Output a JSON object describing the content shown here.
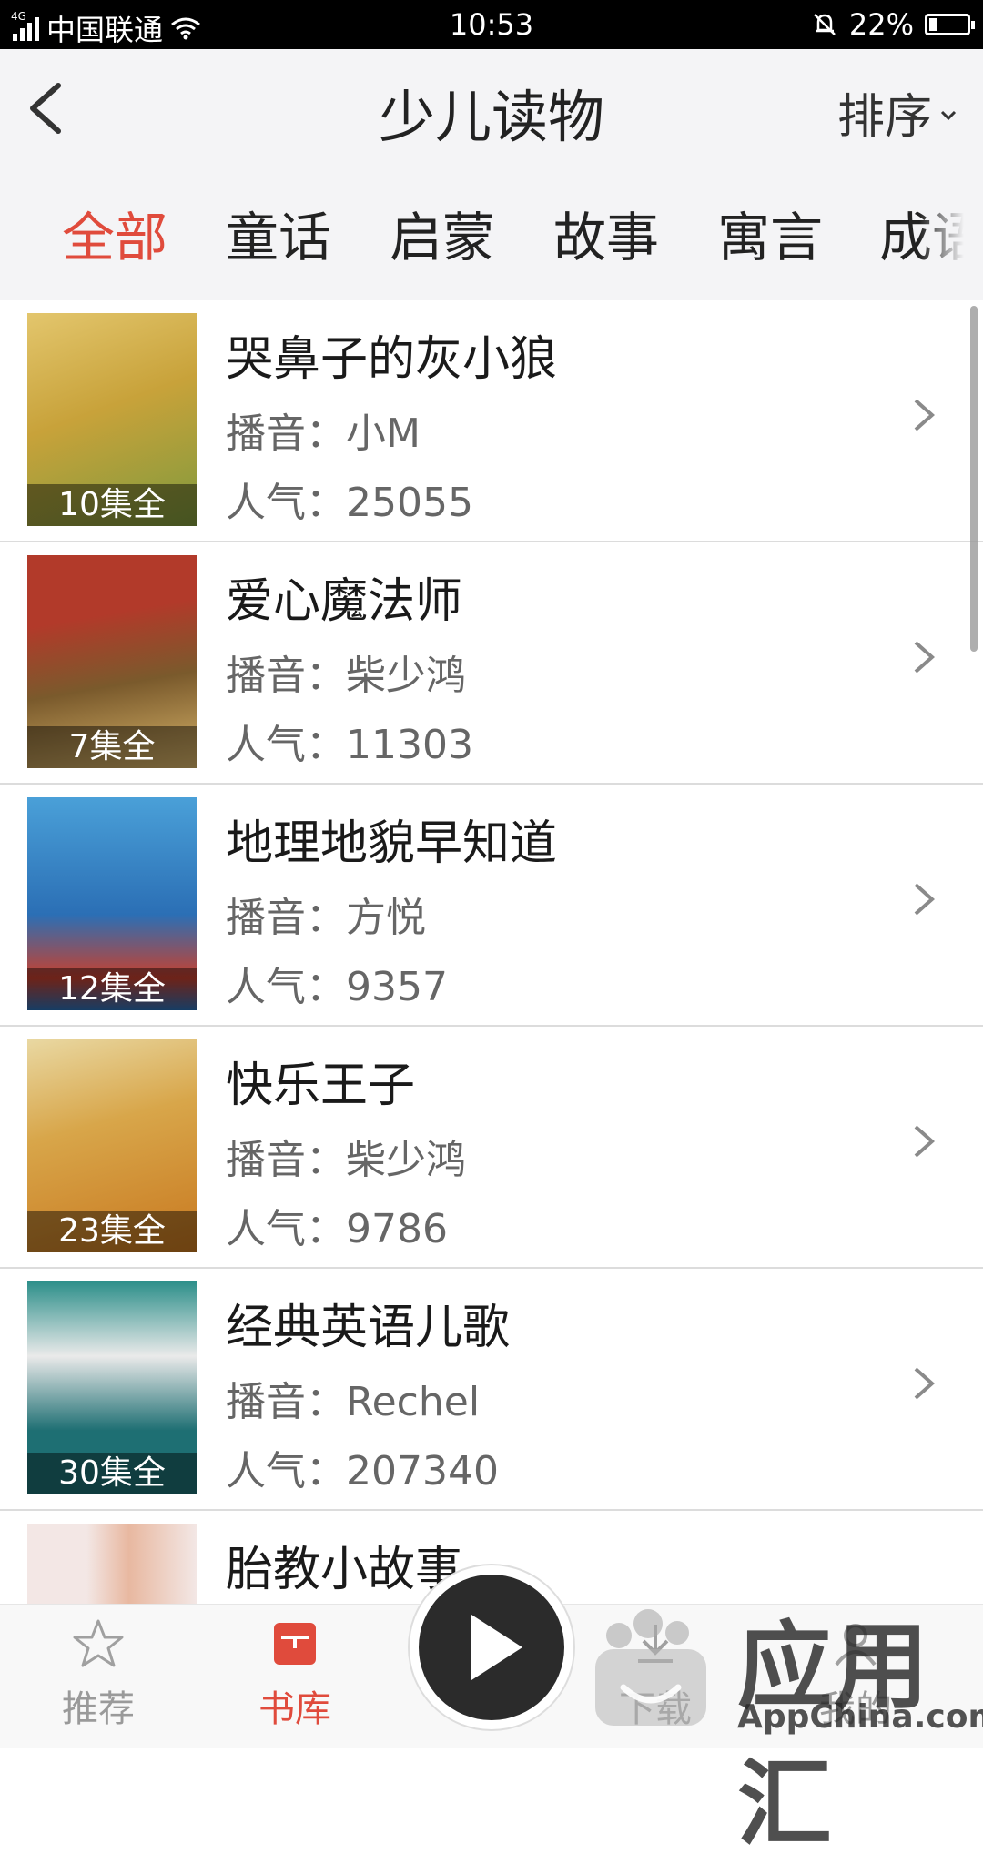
{
  "status_bar": {
    "signal": "4G",
    "carrier": "中国联通",
    "time": "10:53",
    "battery": "22%"
  },
  "header": {
    "title": "少儿读物",
    "sort_label": "排序",
    "back_icon": "chevron-left-icon",
    "sort_icon": "chevron-down-icon"
  },
  "tabs": [
    {
      "label": "全部",
      "active": true
    },
    {
      "label": "童话",
      "active": false
    },
    {
      "label": "启蒙",
      "active": false
    },
    {
      "label": "故事",
      "active": false
    },
    {
      "label": "寓言",
      "active": false
    },
    {
      "label": "成语",
      "active": false
    }
  ],
  "books": [
    {
      "title": "哭鼻子的灰小狼",
      "announcer": "播音：小M",
      "popularity": "人气：25055",
      "episodes": "10集全",
      "cover_colors": [
        "#c8a23a",
        "#7f9a3d",
        "#e3c66d"
      ]
    },
    {
      "title": "爱心魔法师",
      "announcer": "播音：柴少鸿",
      "popularity": "人气：11303",
      "episodes": "7集全",
      "cover_colors": [
        "#b23a2a",
        "#7a5a2c",
        "#d9b56a"
      ]
    },
    {
      "title": "地理地貌早知道",
      "announcer": "播音：方悦",
      "popularity": "人气：9357",
      "episodes": "12集全",
      "cover_colors": [
        "#2b6fb5",
        "#4aa0d8",
        "#c8402d"
      ]
    },
    {
      "title": "快乐王子",
      "announcer": "播音：柴少鸿",
      "popularity": "人气：9786",
      "episodes": "23集全",
      "cover_colors": [
        "#d8a64a",
        "#c8781f",
        "#e9d8a2"
      ]
    },
    {
      "title": "经典英语儿歌",
      "announcer": "播音：Rechel",
      "popularity": "人气：207340",
      "episodes": "30集全",
      "cover_colors": [
        "#1e6f73",
        "#2d8f8a",
        "#eaeaea"
      ]
    },
    {
      "title": "胎教小故事",
      "announcer": "",
      "popularity": "",
      "episodes": "",
      "cover_colors": [
        "#f3e7e5",
        "#c9463d",
        "#e8b8a0"
      ]
    }
  ],
  "bottom_nav": [
    {
      "label": "推荐",
      "icon": "star-icon",
      "active": false
    },
    {
      "label": "书库",
      "icon": "book-icon",
      "active": true
    },
    {
      "label": "下载",
      "icon": "download-icon",
      "active": false
    },
    {
      "label": "我的",
      "icon": "user-icon",
      "active": false
    }
  ],
  "player": {
    "icon": "play-icon"
  },
  "watermark": {
    "text": "应用汇",
    "subtext": "AppChina.com"
  },
  "colors": {
    "accent": "#e04b3c",
    "header_bg": "#f4f4f6"
  }
}
